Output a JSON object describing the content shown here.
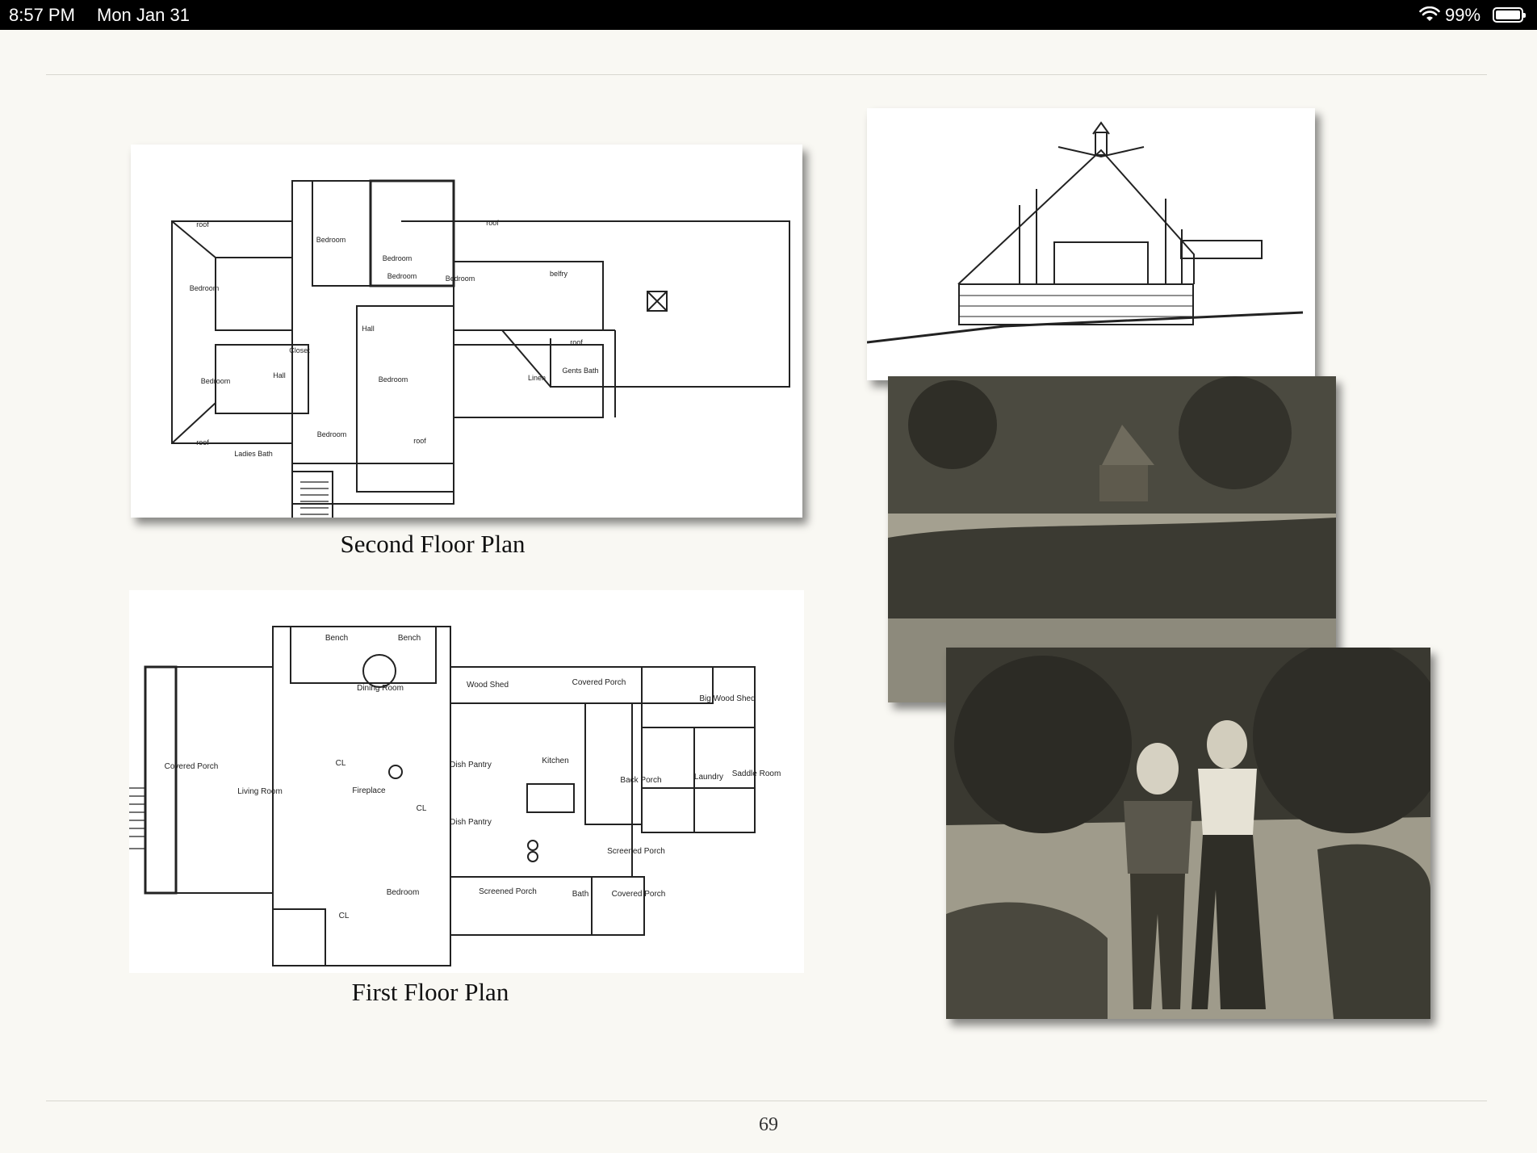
{
  "status_bar": {
    "time": "8:57 PM",
    "date": "Mon Jan 31",
    "battery": "99%",
    "battery_level": 0.99
  },
  "plans": {
    "second": {
      "caption": "Second Floor Plan",
      "labels": [
        "roof",
        "Bedroom",
        "Bedroom",
        "roof",
        "Bedroom",
        "Bedroom",
        "belfry",
        "Bedroom",
        "Hall",
        "Closet",
        "roof",
        "Bedroom",
        "Hall",
        "Bedroom",
        "Linen",
        "Gents Bath",
        "Bedroom",
        "roof",
        "Ladies Bath",
        "roof"
      ]
    },
    "first": {
      "caption": "First Floor Plan",
      "labels": [
        "Bench",
        "Bench",
        "Dining Room",
        "Wood Shed",
        "Covered Porch",
        "Big Wood Shed",
        "Kitchen",
        "Living Room",
        "Covered Porch",
        "Fireplace",
        "Dish Pantry",
        "Dish Pantry",
        "Back Porch",
        "Laundry",
        "Saddle Room",
        "Screened Porch",
        "Bedroom",
        "Screened Porch",
        "Bath",
        "Covered Porch",
        "CL",
        "CL",
        "CL"
      ]
    }
  },
  "page_number": "69"
}
